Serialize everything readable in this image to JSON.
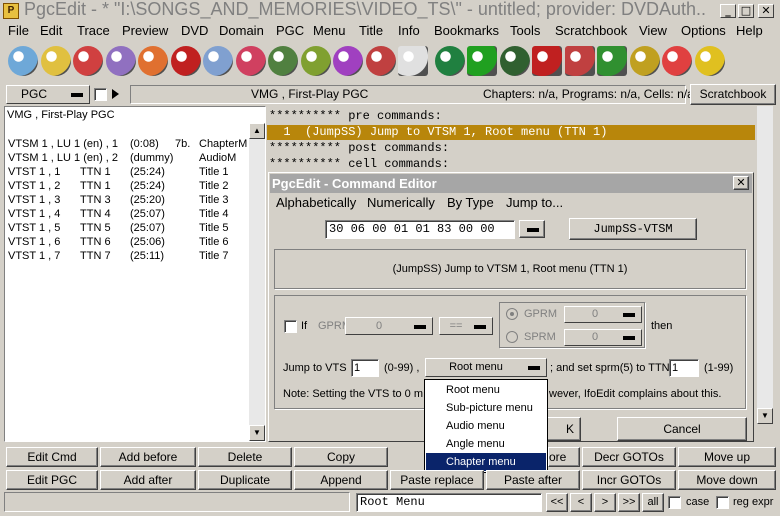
{
  "window": {
    "title": "PgcEdit - * \"I:\\SONGS_AND_MEMORIES\\VIDEO_TS\\\" - untitled; provider: DVDAuth...",
    "icon_text": "P"
  },
  "menu": [
    "File",
    "Edit",
    "Trace",
    "Preview",
    "DVD",
    "Domain",
    "PGC",
    "Menu",
    "Title",
    "Info",
    "Bookmarks",
    "Tools",
    "Scratchbook",
    "View",
    "Options",
    "Help"
  ],
  "toolbar_icons": [
    "open-dvd-icon",
    "open-folder-icon",
    "reload-icon",
    "new-dvd-icon",
    "flame-icon",
    "search-icon",
    "disc-copy-icon",
    "disc-arrow-icon",
    "save-disc-icon",
    "folder-disc-icon",
    "check-disc-icon",
    "id-disc-icon",
    "document-icon",
    "globe-icon",
    "play-preview-icon",
    "film-reel-icon",
    "list-icon",
    "grid-cross-icon",
    "menu-icon",
    "chain-icon",
    "numbers-icon",
    "tcl-icon"
  ],
  "pgcbar": {
    "pgc_label": "PGC",
    "pgc_title": "VMG , First-Play PGC",
    "info": "Chapters: n/a,  Programs: n/a,  Cells: n/a",
    "scratchbook": "Scratchbook"
  },
  "left_list": {
    "header": "VMG , First-Play PGC",
    "rows": [
      [
        "VTSM 1 , LU 1 (en) , 1",
        "(0:08)",
        "7b.",
        "ChapterM"
      ],
      [
        "VTSM 1 , LU 1 (en) , 2",
        "(dummy)",
        "",
        "AudioM"
      ],
      [
        "VTST 1 , 1",
        "TTN 1",
        "(25:24)",
        "Title 1"
      ],
      [
        "VTST 1 , 2",
        "TTN 1",
        "(25:24)",
        "Title 2"
      ],
      [
        "VTST 1 , 3",
        "TTN 3",
        "(25:20)",
        "Title 3"
      ],
      [
        "VTST 1 , 4",
        "TTN 4",
        "(25:07)",
        "Title 4"
      ],
      [
        "VTST 1 , 5",
        "TTN 5",
        "(25:07)",
        "Title 5"
      ],
      [
        "VTST 1 , 6",
        "TTN 6",
        "(25:06)",
        "Title 6"
      ],
      [
        "VTST 1 , 7",
        "TTN 7",
        "(25:11)",
        "Title 7"
      ]
    ]
  },
  "commands": {
    "pre_header": "********** pre commands:",
    "pre_line": "  1  (JumpSS) Jump to VTSM 1, Root menu (TTN 1)",
    "post_header": "********** post commands:",
    "cell_header": "********** cell commands:"
  },
  "dialog": {
    "title": "PgcEdit - Command Editor",
    "menu": [
      "Alphabetically",
      "Numerically",
      "By Type",
      "Jump to..."
    ],
    "hex": "30 06 00 01 01 83 00 00",
    "cmd_name": "JumpSS-VTSM",
    "description": "(JumpSS) Jump to VTSM 1, Root menu (TTN 1)",
    "if_label": "If",
    "gprm_label": "GPRM",
    "gprm_value": "0",
    "op_value": "==",
    "gprm2_label": "GPRM",
    "gprm2_value": "0",
    "sprm_label": "SPRM",
    "sprm_value": "0",
    "then_label": "then",
    "jump_label": "Jump to VTS",
    "vts_value": "1",
    "vts_range": "(0-99) ,",
    "menu_value": "Root menu",
    "sprm_text": "; and set sprm(5) to TTN",
    "ttn_value": "1",
    "ttn_range": "(1-99)",
    "note_a": "Note: Setting the VTS to 0 m",
    "note_b": "wever, IfoEdit complains about this.",
    "ok_partial": "K",
    "cancel": "Cancel"
  },
  "popup": {
    "items": [
      "Root menu",
      "Sub-picture menu",
      "Audio menu",
      "Angle menu",
      "Chapter menu"
    ],
    "selected": 4
  },
  "buttons": {
    "row1": [
      "Edit Cmd",
      "Add before",
      "Delete",
      "Copy",
      "ore",
      "Decr GOTOs",
      "Move up"
    ],
    "row2": [
      "Edit PGC",
      "Add after",
      "Duplicate",
      "Append",
      "Paste replace",
      "Paste after",
      "Incr GOTOs",
      "Move down"
    ]
  },
  "search": {
    "value": "Root Menu",
    "nav": [
      "<<",
      "<",
      ">",
      ">>"
    ],
    "all": "all",
    "case": "case",
    "regexp": "reg expr"
  }
}
